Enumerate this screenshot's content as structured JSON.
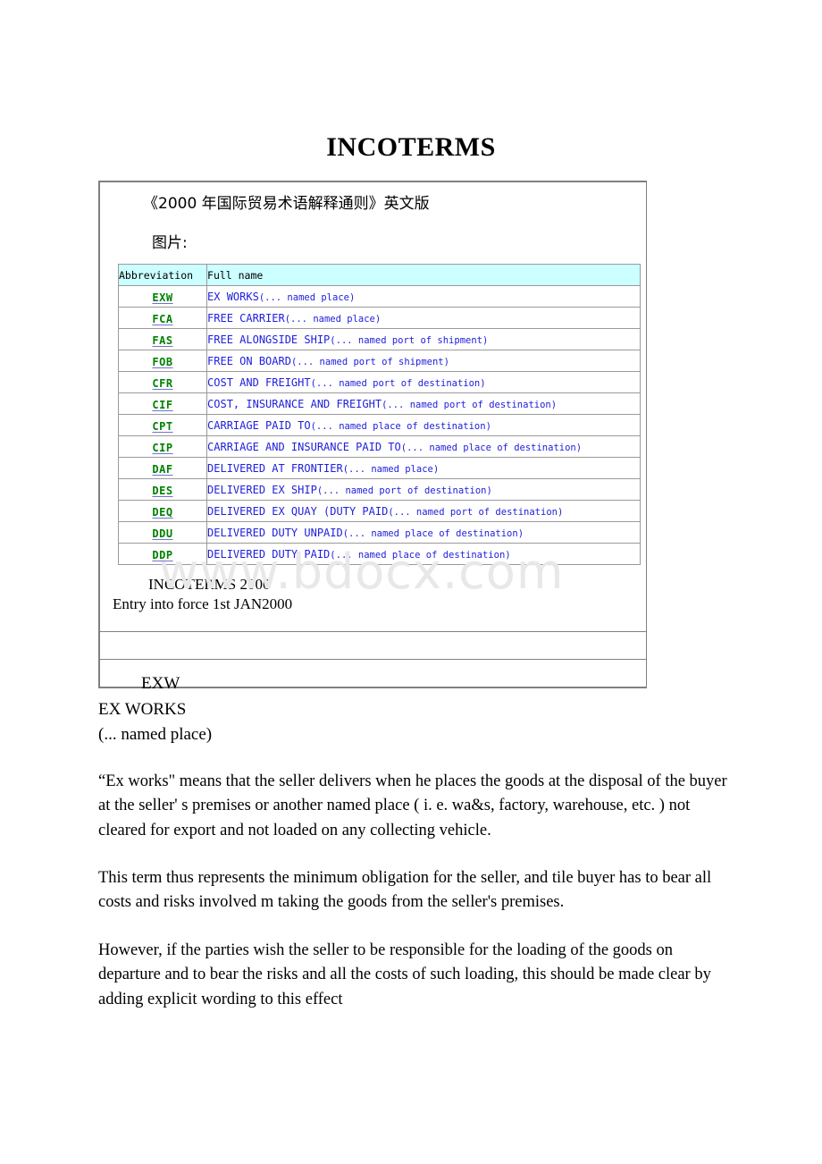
{
  "document": {
    "title": "INCOTERMS",
    "chinese_heading": "《2000 年国际贸易术语解释通则》英文版",
    "chinese_label": "图片:",
    "watermark": "www.bdocx.com"
  },
  "table": {
    "headers": {
      "abbreviation": "Abbreviation",
      "full_name": "Full name"
    },
    "rows": [
      {
        "abbr": "EXW",
        "term": "EX WORKS",
        "qual": "(... named place)"
      },
      {
        "abbr": "FCA",
        "term": "FREE CARRIER",
        "qual": "(... named place)"
      },
      {
        "abbr": "FAS",
        "term": "FREE ALONGSIDE SHIP",
        "qual": "(... named port of shipment)"
      },
      {
        "abbr": "FOB",
        "term": "FREE ON BOARD",
        "qual": "(... named port of shipment)"
      },
      {
        "abbr": "CFR",
        "term": "COST AND FREIGHT",
        "qual": "(... named port of destination)"
      },
      {
        "abbr": "CIF",
        "term": "COST, INSURANCE AND FREIGHT",
        "qual": "(... named port of destination)"
      },
      {
        "abbr": "CPT",
        "term": "CARRIAGE PAID TO",
        "qual": "(... named place of destination)"
      },
      {
        "abbr": "CIP",
        "term": "CARRIAGE AND INSURANCE  PAID TO",
        "qual": "(... named place of destination)"
      },
      {
        "abbr": "DAF",
        "term": "DELIVERED AT FRONTIER",
        "qual": "(... named place)"
      },
      {
        "abbr": "DES",
        "term": "DELIVERED EX SHIP",
        "qual": "(... named port of destination)"
      },
      {
        "abbr": "DEQ",
        "term": "DELIVERED EX QUAY  (DUTY PAID",
        "qual": "(... named port of destination)"
      },
      {
        "abbr": "DDU",
        "term": "DELIVERED DUTY UNPAID",
        "qual": "(... named place of destination)"
      },
      {
        "abbr": "DDP",
        "term": "DELIVERED DUTY PAID",
        "qual": "(... named place of destination)"
      }
    ],
    "footer": {
      "line1": "INCOTERMS 2000",
      "line2": "Entry into force 1st JAN2000"
    }
  },
  "body": {
    "term_code": "EXW",
    "term_name": "EX WORKS",
    "term_qualifier": "(... named place)",
    "paragraphs": [
      "“Ex works\" means that the seller delivers when he places the goods at the disposal of the buyer at the seller' s premises or another named place ( i. e. wa&s, factory, warehouse, etc. ) not cleared for export and not loaded on any collecting vehicle.",
      "This term thus represents the minimum obligation for the seller, and tile buyer has to bear all costs and risks involved m taking the goods from the seller's premises.",
      "However, if the parties wish the seller to be responsible for the loading of the goods on departure and to bear the risks and all the costs of such loading, this should be made clear by adding explicit wording to this effect"
    ]
  },
  "colors": {
    "header_bg": "#ccffff",
    "abbr_text": "#008000",
    "full_text": "#2020dd",
    "border": "#9a9a9a",
    "watermark": "#e8e8e8"
  }
}
